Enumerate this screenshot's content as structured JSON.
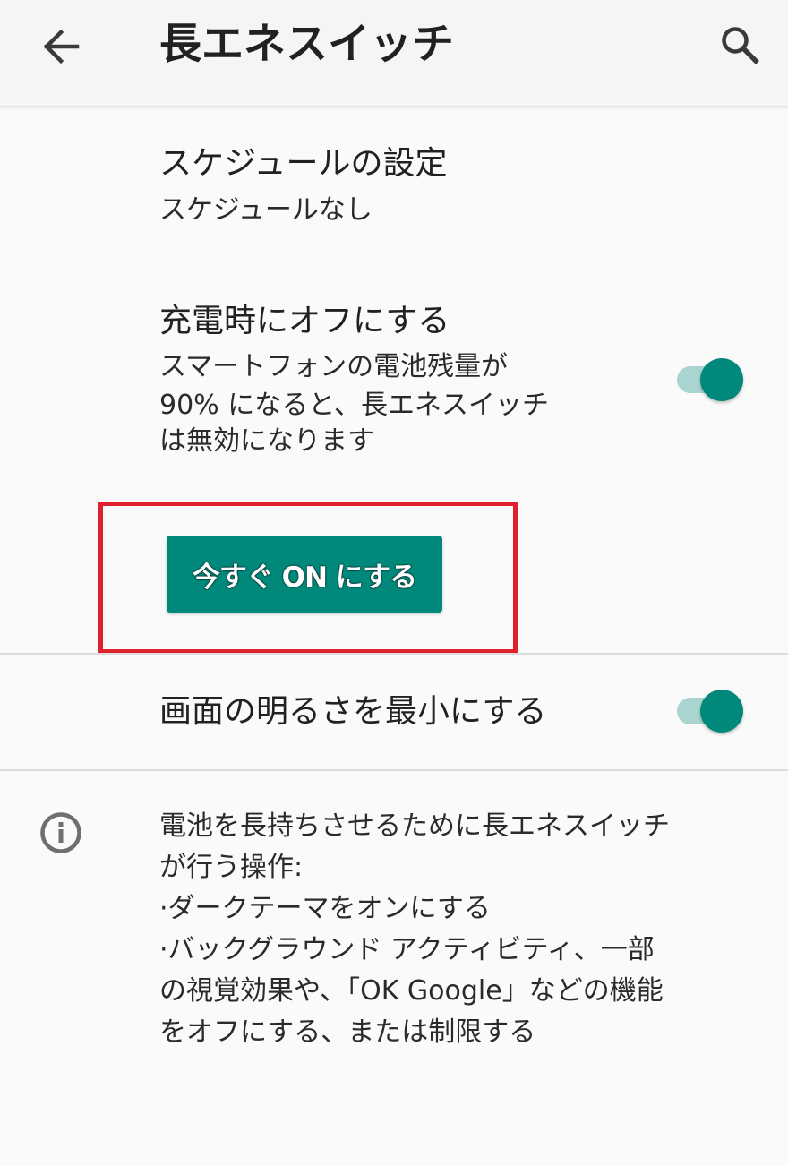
{
  "appbar": {
    "title": "長エネスイッチ",
    "back_icon": "arrow-back-icon",
    "search_icon": "search-icon"
  },
  "schedule": {
    "title": "スケジュールの設定",
    "summary": "スケジュールなし"
  },
  "charging_off": {
    "title": "充電時にオフにする",
    "summary_lines": [
      "スマートフォンの電池残量が",
      "90% になると、長エネスイッチ",
      "は無効になります"
    ],
    "toggle_on": true
  },
  "action": {
    "turn_on_label": "今すぐ ON にする"
  },
  "min_brightness": {
    "title": "画面の明るさを最小にする",
    "toggle_on": true
  },
  "info": {
    "icon": "info-icon",
    "lines": [
      "電池を長持ちさせるために長エネスイッチ",
      "が行う操作:",
      "·ダークテーマをオンにする",
      "·バックグラウンド アクティビティ、一部",
      "の視覚効果や、「OK Google」などの機能",
      "をオフにする、または制限する"
    ]
  },
  "colors": {
    "accent": "#00897b",
    "switch_track": "#a9d4cf",
    "highlight": "#e0202e"
  }
}
